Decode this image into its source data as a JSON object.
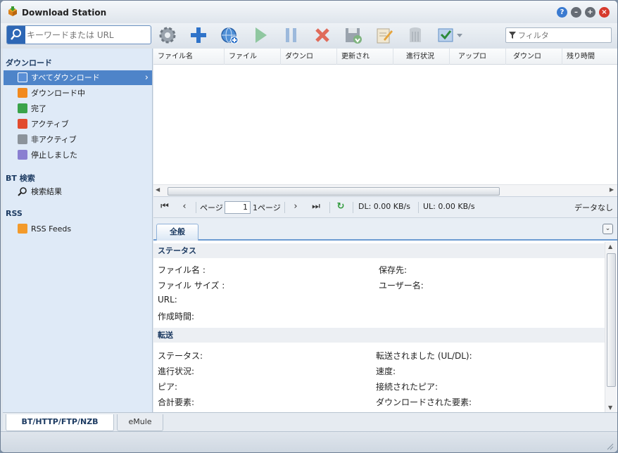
{
  "window": {
    "title": "Download Station"
  },
  "search": {
    "placeholder": "キーワードまたは URL"
  },
  "filter": {
    "placeholder": "フィルタ"
  },
  "sidebar": {
    "download_header": "ダウンロード",
    "items": [
      {
        "label": "すべてダウンロード",
        "icon": "list-icon"
      },
      {
        "label": "ダウンロード中",
        "icon": "download-icon"
      },
      {
        "label": "完了",
        "icon": "check-icon"
      },
      {
        "label": "アクティブ",
        "icon": "active-icon"
      },
      {
        "label": "非アクティブ",
        "icon": "inactive-icon"
      },
      {
        "label": "停止しました",
        "icon": "pause-icon"
      }
    ],
    "bt_header": "BT 検索",
    "bt_item": "検索結果",
    "rss_header": "RSS",
    "rss_item": "RSS Feeds"
  },
  "grid": {
    "columns": [
      "ファイル名",
      "ファイル",
      "ダウンロ",
      "更新され",
      "進行状況",
      "アップロ",
      "ダウンロ",
      "残り時間"
    ]
  },
  "pager": {
    "page_label": "ページ",
    "page_value": "1",
    "of_pages": "1ページ",
    "dl": "DL: 0.00 KB/s",
    "ul": "UL: 0.00 KB/s",
    "no_data": "データなし"
  },
  "details": {
    "tab": "全般",
    "status_header": "ステータス",
    "status_fields": {
      "filename": "ファイル名 :",
      "filesize": "ファイル サイズ :",
      "url": "URL:",
      "created": "作成時間:",
      "dest": "保存先:",
      "user": "ユーザー名:"
    },
    "transfer_header": "転送",
    "transfer_fields": {
      "status": "ステータス:",
      "progress": "進行状況:",
      "peers": "ピア:",
      "total": "合計要素:",
      "transferred": "転送されました (UL/DL):",
      "speed": "速度:",
      "connected": "接続されたピア:",
      "downloaded": "ダウンロードされた要素:"
    }
  },
  "bottom_tabs": [
    "BT/HTTP/FTP/NZB",
    "eMule"
  ],
  "colors": {
    "accent": "#4e84c9",
    "sidebar_bg": "#dfeaf7"
  }
}
